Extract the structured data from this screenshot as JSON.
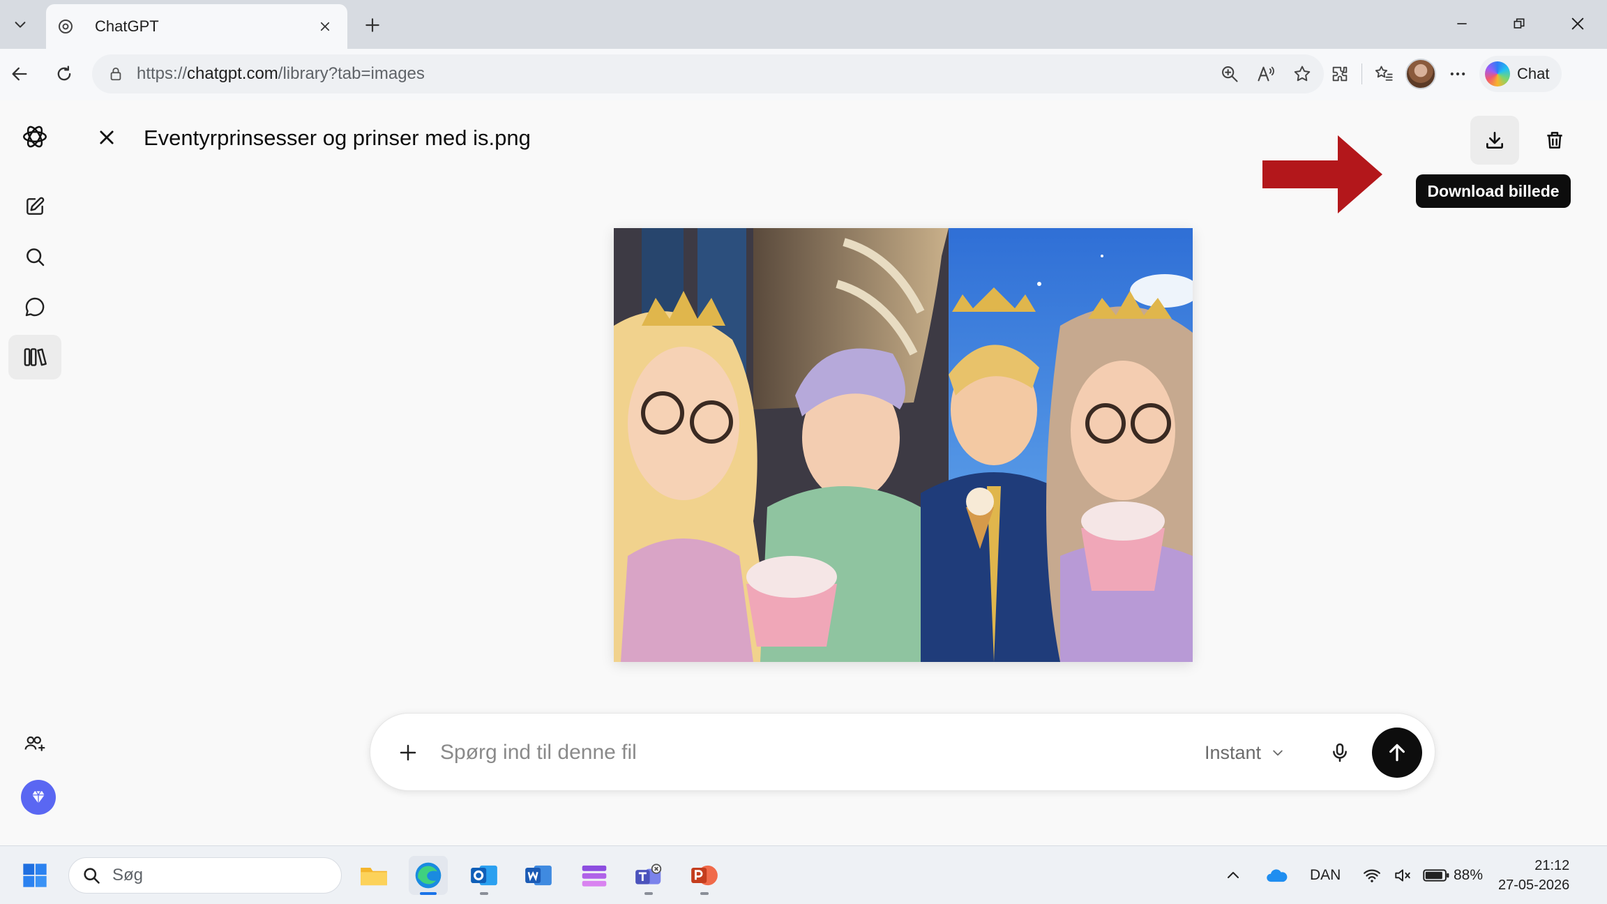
{
  "browser": {
    "tab": {
      "title": "ChatGPT"
    },
    "url": {
      "prefix": "https://",
      "host": "chatgpt.com",
      "path": "/library?tab=images"
    },
    "copilot_label": "Chat"
  },
  "sidebar": {
    "items": [
      {
        "icon": "openai-logo-icon"
      },
      {
        "icon": "new-chat-icon"
      },
      {
        "icon": "search-icon"
      },
      {
        "icon": "chat-bubble-icon"
      },
      {
        "icon": "library-icon",
        "active": true
      },
      {
        "icon": "invite-people-icon"
      },
      {
        "icon": "gem-icon"
      }
    ]
  },
  "viewer": {
    "file_name": "Eventyrprinsesser og prinser med is.png",
    "tooltip": "Download billede"
  },
  "composer": {
    "placeholder": "Spørg ind til denne fil",
    "model": "Instant"
  },
  "taskbar": {
    "search_label": "Søg",
    "language": "DAN",
    "battery": "88%",
    "time": "21:12",
    "date": "27-05-2026"
  },
  "colors": {
    "accent_send": "#0d0d0d",
    "tooltip_bg": "#0d0d0d",
    "annotation_arrow": "#b3171b",
    "gem_button": "#5a67f2"
  }
}
